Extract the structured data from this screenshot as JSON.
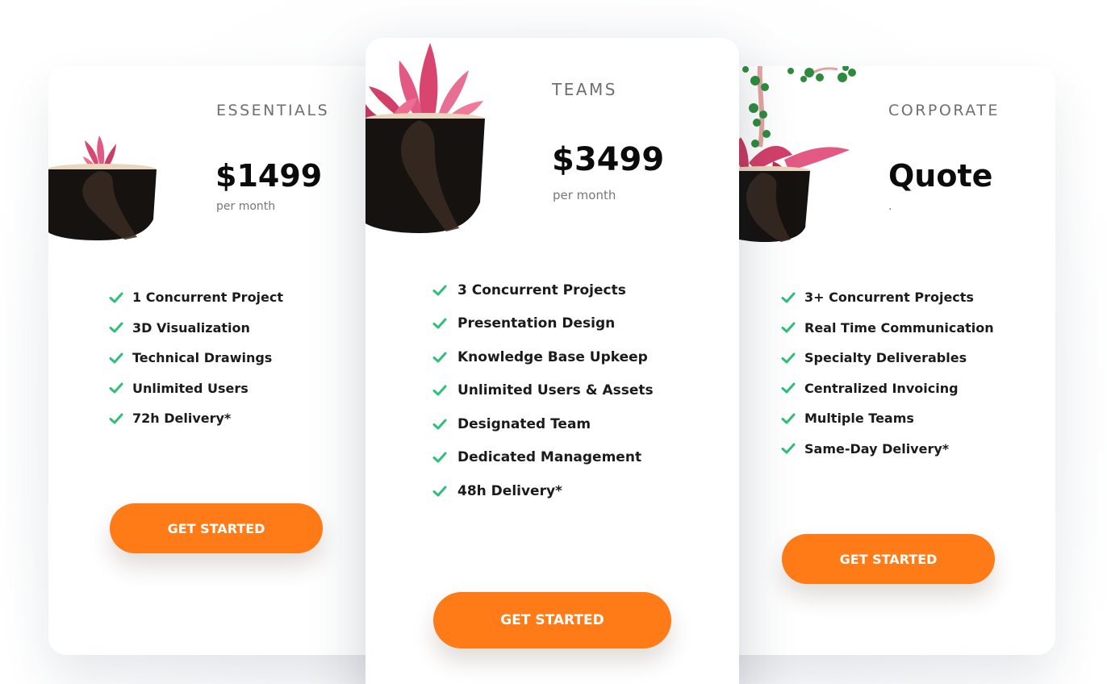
{
  "accent_color": "#ff7b17",
  "check_color": "#2fbf7a",
  "plans": [
    {
      "name": "ESSENTIALS",
      "price": "$1499",
      "period": "per month",
      "features": [
        "1 Concurrent Project",
        "3D Visualization",
        "Technical Drawings",
        "Unlimited Users",
        "72h Delivery*"
      ],
      "cta": "GET STARTED"
    },
    {
      "name": "TEAMS",
      "price": "$3499",
      "period": "per month",
      "features": [
        "3 Concurrent Projects",
        "Presentation Design",
        "Knowledge Base Upkeep",
        "Unlimited Users & Assets",
        "Designated Team",
        "Dedicated Management",
        "48h Delivery*"
      ],
      "cta": "GET STARTED"
    },
    {
      "name": "CORPORATE",
      "price": "Quote",
      "period": ".",
      "features": [
        "3+ Concurrent Projects",
        "Real Time Communication",
        "Specialty Deliverables",
        "Centralized Invoicing",
        "Multiple Teams",
        "Same-Day Delivery*"
      ],
      "cta": "GET STARTED"
    }
  ]
}
